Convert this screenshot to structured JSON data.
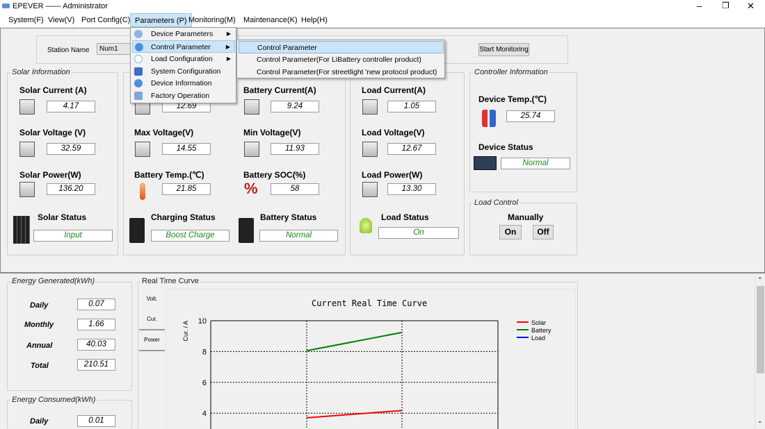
{
  "window": {
    "title": "EPEVER —— Administrator",
    "controls": {
      "minimize": "–",
      "restore": "❐",
      "close": "✕"
    }
  },
  "menubar": [
    "System(F)",
    "View(V)",
    "Port Config(C)",
    "Parameters (P)",
    "Monitoring(M)",
    "Maintenance(K)",
    "Help(H)"
  ],
  "parameters_menu": {
    "items": [
      "Device Parameters",
      "Control Parameter",
      "Load Configuration",
      "System Configuration",
      "Device Information",
      "Factory Operation"
    ],
    "submenu": [
      "Control Parameter",
      "Control Parameter(For LiBattery controller product)",
      "Control Parameter(For streetlight 'new protocol product)"
    ]
  },
  "station": {
    "label": "Station Name",
    "value": "Num1",
    "start_button": "Start Monitoring"
  },
  "solar": {
    "group": "Solar Information",
    "current_label": "Solar Current (A)",
    "current": "4.17",
    "voltage_label": "Solar Voltage (V)",
    "voltage": "32.59",
    "power_label": "Solar Power(W)",
    "power": "136.20",
    "status_label": "Solar Status",
    "status": "Input"
  },
  "battery": {
    "voltage": "12.69",
    "max_label": "Max Voltage(V)",
    "max": "14.55",
    "temp_label": "Battery Temp.(℃)",
    "temp": "21.85",
    "charging_label": "Charging Status",
    "charging": "Boost Charge",
    "current_label": "Battery Current(A)",
    "current": "9.24",
    "min_label": "Min Voltage(V)",
    "min": "11.93",
    "soc_label": "Battery SOC(%)",
    "soc": "58",
    "status_label": "Battery Status",
    "status": "Normal"
  },
  "load": {
    "current_label": "Load Current(A)",
    "current": "1.05",
    "voltage_label": "Load Voltage(V)",
    "voltage": "12.67",
    "power_label": "Load Power(W)",
    "power": "13.30",
    "status_label": "Load Status",
    "status": "On"
  },
  "controller": {
    "group": "Controller Information",
    "temp_label": "Device Temp.(℃)",
    "temp": "25.74",
    "status_label": "Device Status",
    "status": "Normal"
  },
  "load_control": {
    "group": "Load Control",
    "mode": "Manually",
    "on": "On",
    "off": "Off"
  },
  "energy_generated": {
    "group": "Energy Generated(kWh)",
    "rows": [
      {
        "label": "Daily",
        "value": "0.07"
      },
      {
        "label": "Monthly",
        "value": "1.66"
      },
      {
        "label": "Annual",
        "value": "40.03"
      },
      {
        "label": "Total",
        "value": "210.51"
      }
    ]
  },
  "energy_consumed": {
    "group": "Energy Consumed(kWh)",
    "rows": [
      {
        "label": "Daily",
        "value": "0.01"
      }
    ]
  },
  "curve": {
    "group": "Real Time Curve",
    "tabs": [
      "Volt.",
      "Cur.",
      "Power"
    ],
    "active_tab": "Cur."
  },
  "chart_data": {
    "type": "line",
    "title": "Current Real Time Curve",
    "ylabel": "Cur. / A",
    "ylim_visible": [
      3.5,
      10
    ],
    "yticks": [
      4,
      6,
      8,
      10
    ],
    "grid": true,
    "legend": "top-right",
    "series": [
      {
        "name": "Solar",
        "color": "#ff0000",
        "values": [
          3.7,
          4.17
        ]
      },
      {
        "name": "Battery",
        "color": "#008000",
        "values": [
          8.05,
          9.24
        ]
      },
      {
        "name": "Load",
        "color": "#0000ff",
        "values": []
      }
    ]
  }
}
